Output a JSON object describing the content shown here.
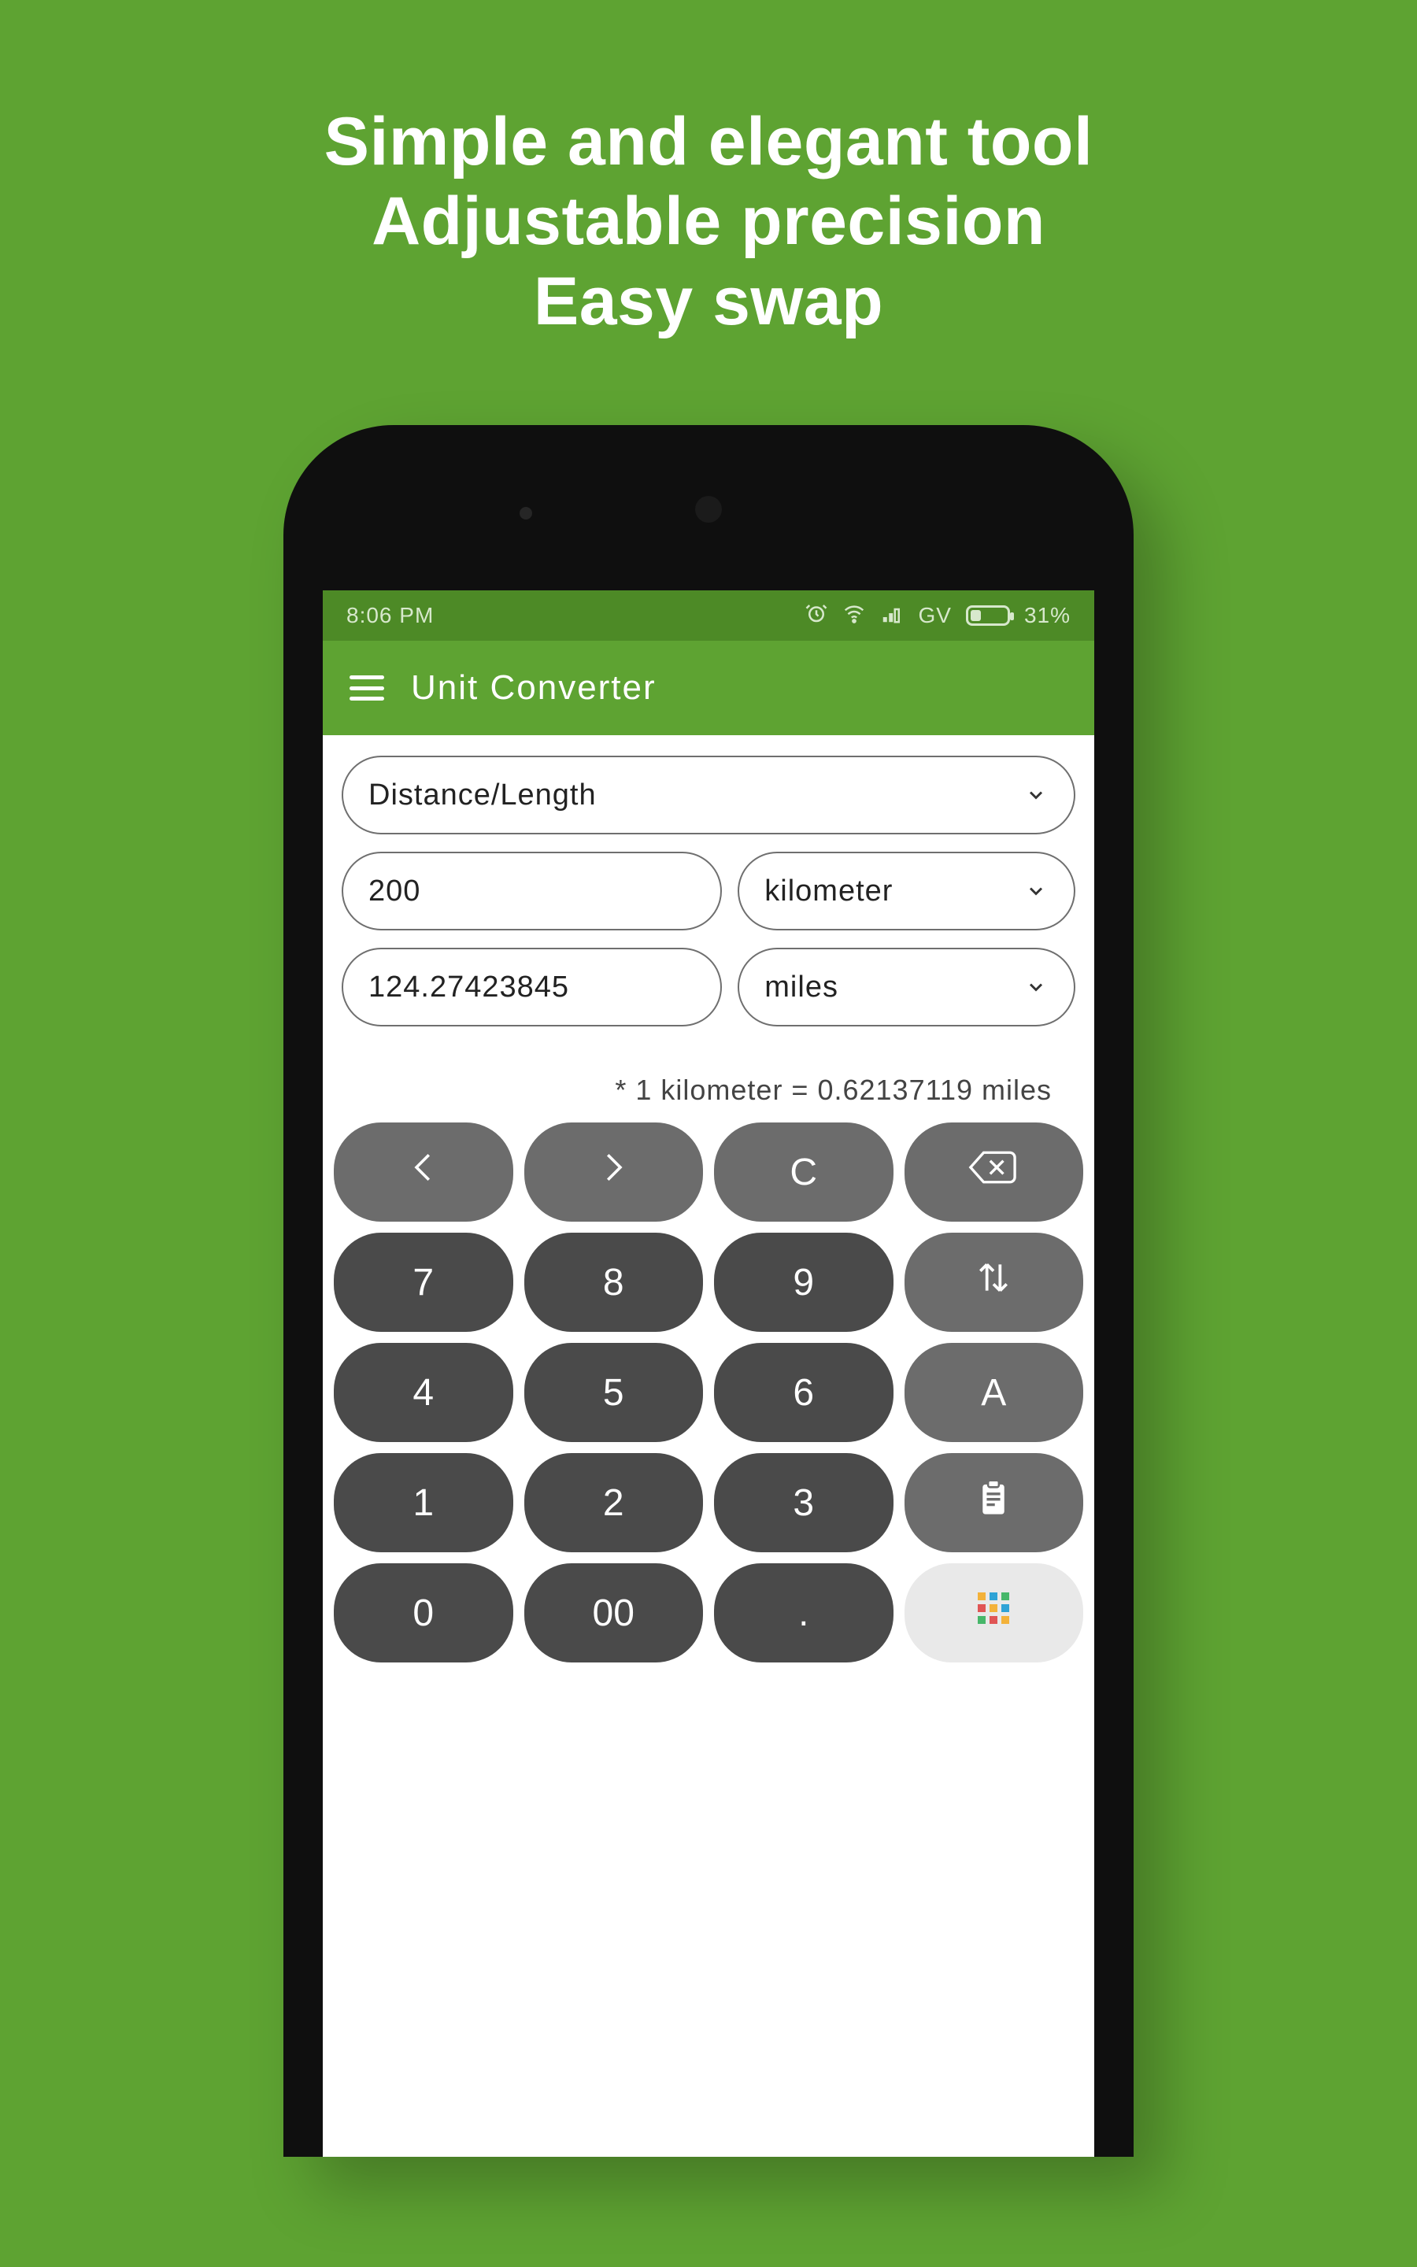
{
  "promo": {
    "line1": "Simple and elegant tool",
    "line2": "Adjustable precision",
    "line3": "Easy swap"
  },
  "statusbar": {
    "time": "8:06 PM",
    "carrier": "GV",
    "battery_pct": "31%"
  },
  "appbar": {
    "title": "Unit Converter",
    "menu_icon": "hamburger-icon"
  },
  "converter": {
    "category": "Distance/Length",
    "input_value": "200",
    "input_unit": "kilometer",
    "output_value": "124.27423845",
    "output_unit": "miles",
    "rate_text": "* 1 kilometer = 0.62137119 miles"
  },
  "keypad": {
    "rows": [
      [
        "prev-icon",
        "next-icon",
        "C",
        "backspace-icon"
      ],
      [
        "7",
        "8",
        "9",
        "swap-icon"
      ],
      [
        "4",
        "5",
        "6",
        "A"
      ],
      [
        "1",
        "2",
        "3",
        "clipboard-icon"
      ],
      [
        "0",
        "00",
        ".",
        "apps-icon"
      ]
    ],
    "labels": {
      "clear": "C",
      "k7": "7",
      "k8": "8",
      "k9": "9",
      "k4": "4",
      "k5": "5",
      "k6": "6",
      "k1": "1",
      "k2": "2",
      "k3": "3",
      "k0": "0",
      "k00": "00",
      "dot": ".",
      "all": "A"
    }
  },
  "colors": {
    "bg": "#5ea332",
    "statusbar": "#4d8a26",
    "key_dark": "#4a4a4a",
    "key_light": "#6c6c6c"
  }
}
